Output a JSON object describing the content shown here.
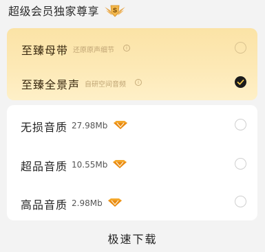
{
  "header": {
    "title": "超级会员独家尊享",
    "badge_text": "S"
  },
  "premium_options": [
    {
      "name": "至臻母带",
      "desc": "还原原声细节",
      "info": "i",
      "selected": false
    },
    {
      "name": "至臻全景声",
      "desc": "自研空间音频",
      "info": "i",
      "selected": true
    }
  ],
  "quality_options": [
    {
      "name": "无损音质",
      "size": "27.98Mb",
      "selected": false
    },
    {
      "name": "超品音质",
      "size": "10.55Mb",
      "selected": false
    },
    {
      "name": "高品音质",
      "size": "2.98Mb",
      "selected": false
    }
  ],
  "bottom": {
    "download_label": "极速下载"
  },
  "colors": {
    "premium_gradient_top": "#fbe3a6",
    "premium_gradient_bottom": "#fef0c8",
    "diamond_orange": "#f19a1c",
    "check_dark": "#1b1b1b",
    "check_mark": "#f5c94a"
  },
  "icons": {
    "badge": "vip-wings-badge-icon",
    "diamond": "vip-diamond-icon",
    "info": "info-circle-icon",
    "check": "check-icon"
  }
}
